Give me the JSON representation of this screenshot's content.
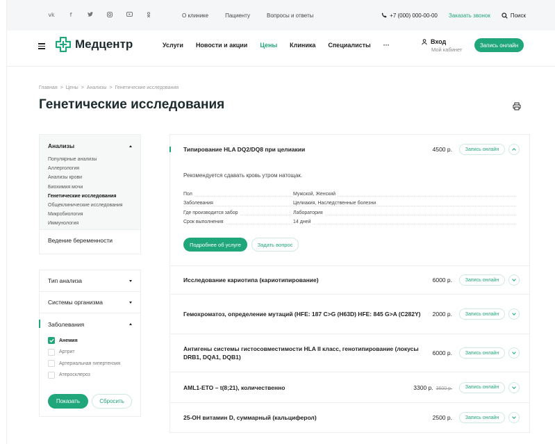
{
  "topbar": {
    "social": [
      "vk",
      "f",
      "tw",
      "ig",
      "yt",
      "ok"
    ],
    "links": [
      "О клинике",
      "Пациенту",
      "Вопросы и ответы"
    ],
    "phone": "+7 (000) 000-00-00",
    "callback": "Заказать звонок",
    "search": "Поиск"
  },
  "header": {
    "logo": "Медцентр",
    "nav": [
      "Услуги",
      "Новости и акции",
      "Цены",
      "Клиника",
      "Специалисты",
      "···"
    ],
    "active_nav": "Цены",
    "login": "Вход",
    "cabinet": "Мой кабинет",
    "book": "Запись онлайн"
  },
  "breadcrumb": [
    "Главная",
    "Цены",
    "Анализы",
    "Генетические исследования"
  ],
  "breadcrumb_sep": ">",
  "title": "Генетические исследования",
  "sidebar": {
    "section": "Анализы",
    "items": [
      {
        "label": "Популярные анализы",
        "active": false
      },
      {
        "label": "Аллергология",
        "active": false
      },
      {
        "label": "Анализы крови",
        "active": false
      },
      {
        "label": "Биохимия мочи",
        "active": false
      },
      {
        "label": "Генетические исследования",
        "active": true
      },
      {
        "label": "Общеклинические исследования",
        "active": false
      },
      {
        "label": "Микробиология",
        "active": false
      },
      {
        "label": "Иммунология",
        "active": false
      }
    ],
    "pregnancy": "Ведение беременности"
  },
  "filters": {
    "groups": [
      "Тип анализа",
      "Системы организма",
      "Заболевания"
    ],
    "options": [
      {
        "label": "Анемия",
        "checked": true
      },
      {
        "label": "Артрит",
        "checked": false
      },
      {
        "label": "Артериальная гипертензия",
        "checked": false
      },
      {
        "label": "Атеросклероз",
        "checked": false
      }
    ],
    "show": "Показать",
    "reset": "Сбросить"
  },
  "services": [
    {
      "title": "Типирование HLA DQ2/DQ8 при целиакии",
      "price": "4500 р.",
      "old_price": "",
      "expanded": true,
      "note": "Рекомендуется сдавать кровь утром натощак.",
      "props": [
        {
          "k": "Пол",
          "v": "Мужской, Женский"
        },
        {
          "k": "Заболевания",
          "v": "Целиакия, Наследственные болезни"
        },
        {
          "k": "Где производится забор",
          "v": "Лаборатория"
        },
        {
          "k": "Срок выполнения",
          "v": "14 дней"
        }
      ],
      "more": "Подробнее об услуге",
      "ask": "Задать вопрос"
    },
    {
      "title": "Исследование кариотипа (кариотипирование)",
      "price": "6000 р.",
      "old_price": "",
      "expanded": false,
      "h": 40
    },
    {
      "title": "Гемохроматоз, определение мутаций (HFE: 187 C>G (H63D) HFE: 845 G>A (C282Y)",
      "price": "2000 р.",
      "old_price": "",
      "expanded": false,
      "h": 56
    },
    {
      "title": "Антигены системы гистосовместимости HLA II класс, генотипирование (локусы DRB1, DQA1, DQB1)",
      "price": "6000 р.",
      "old_price": "",
      "expanded": false,
      "h": 54
    },
    {
      "title": "AML1-ETO – t(8;21), количественно",
      "price": "3300 р.",
      "old_price": "3600 р.",
      "expanded": false,
      "h": 43
    },
    {
      "title": "25-ОН витамин D, суммарный (кальциферол)",
      "price": "2500 р.",
      "old_price": "",
      "expanded": false,
      "h": 42
    }
  ],
  "book_label": "Запись онлайн",
  "colors": {
    "accent": "#1fa67a",
    "text": "#222222",
    "panel": "#f6f7f7"
  }
}
